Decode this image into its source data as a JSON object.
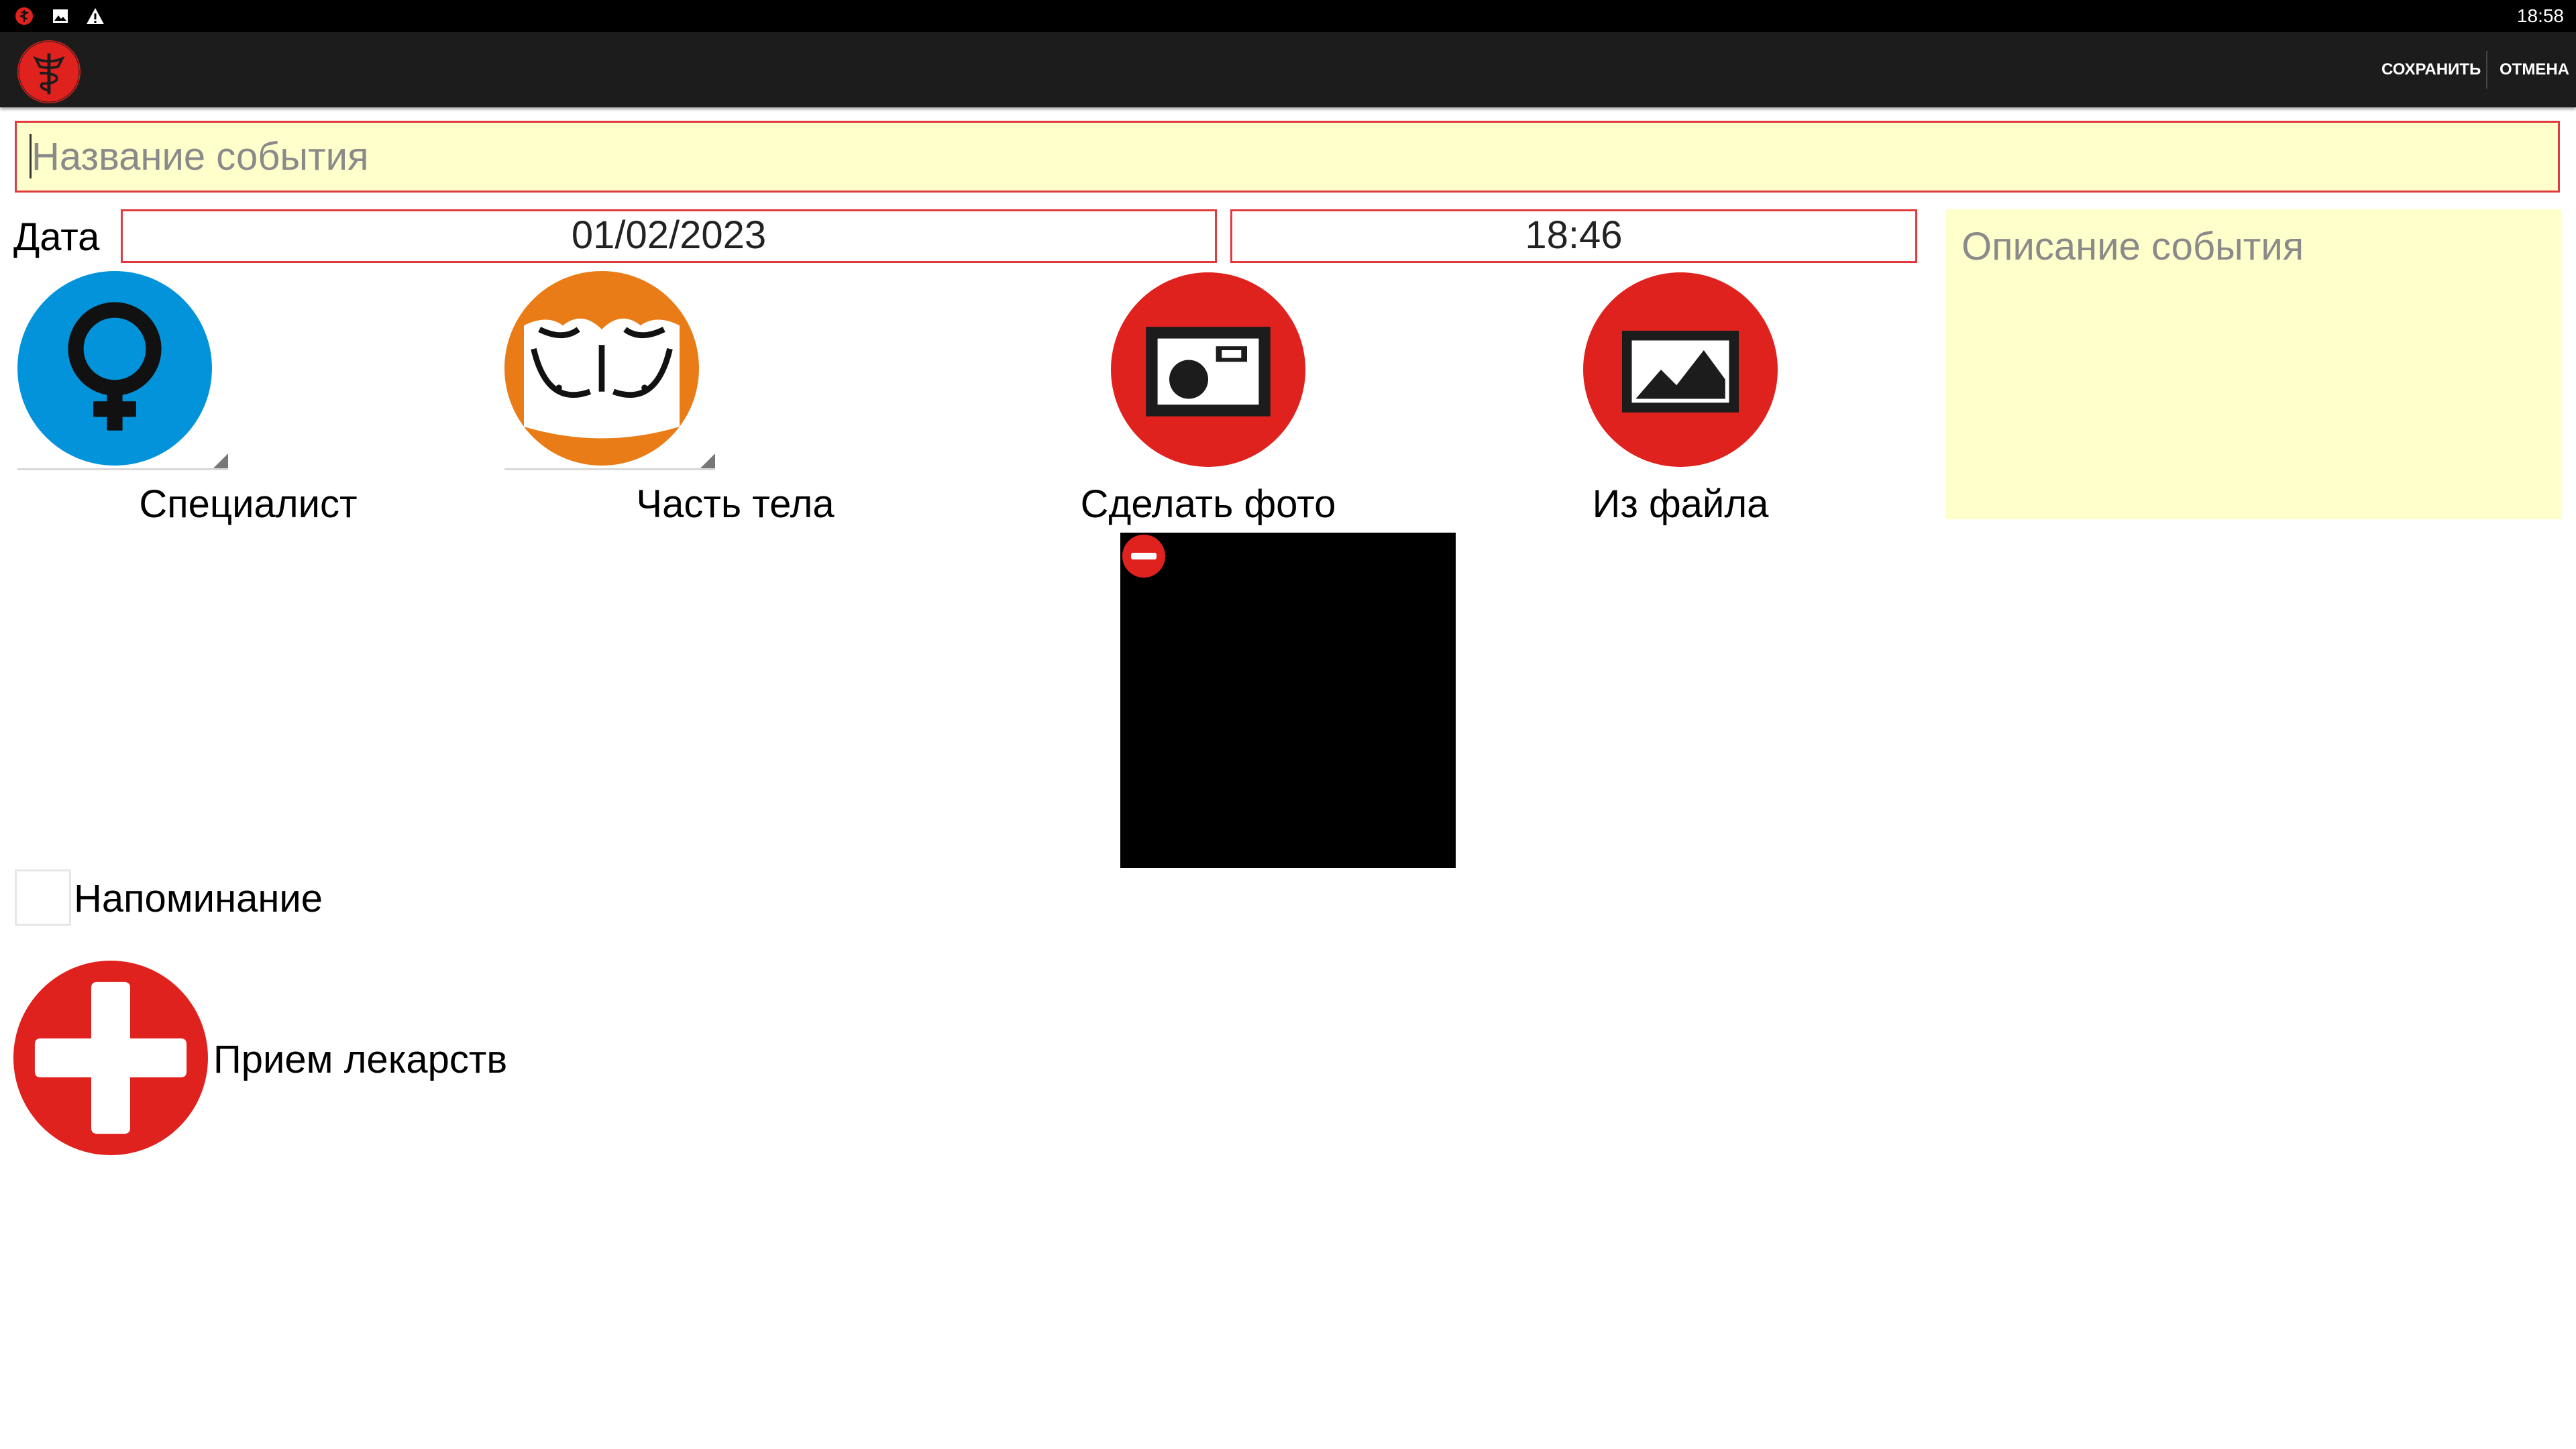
{
  "status_bar": {
    "time": "18:58",
    "icons": [
      "app-notification-icon",
      "image-notification-icon",
      "warning-notification-icon"
    ]
  },
  "action_bar": {
    "logo": "caduceus-logo",
    "save_label": "Сохранить",
    "cancel_label": "Отмена"
  },
  "event": {
    "title_placeholder": "Название события",
    "title_value": "",
    "date_label": "Дата",
    "date": "01/02/2023",
    "time": "18:46",
    "description_placeholder": "Описание события",
    "description_value": ""
  },
  "actions": {
    "specialist": {
      "label": "Специалист",
      "icon": "female-symbol-icon"
    },
    "body_part": {
      "label": "Часть тела",
      "icon": "torso-icon"
    },
    "take_photo": {
      "label": "Сделать фото",
      "icon": "camera-icon"
    },
    "from_file": {
      "label": "Из файла",
      "icon": "picture-icon"
    }
  },
  "photo": {
    "remove_icon": "remove-icon"
  },
  "reminder": {
    "label": "Напоминание",
    "checked": false
  },
  "medication": {
    "label": "Прием лекарств",
    "icon": "medical-cross-icon"
  },
  "colors": {
    "accent_red": "#e0221f",
    "specialist_blue": "#0393db",
    "body_orange": "#e97c17",
    "field_yellow": "#ffffcc",
    "field_border": "#e0393e",
    "actionbar": "#1c1c1c"
  }
}
